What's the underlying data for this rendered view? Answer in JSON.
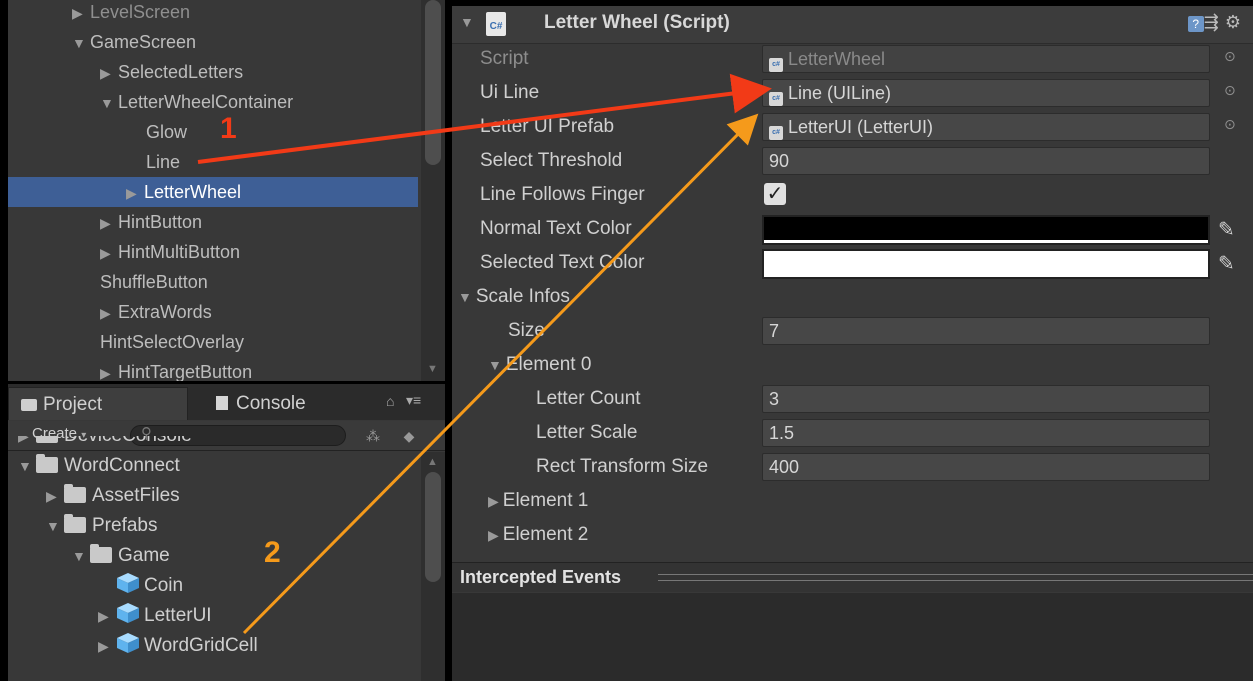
{
  "hierarchy": {
    "items": [
      {
        "label": "LevelScreen",
        "arrow": "▶",
        "indent": 1,
        "state": "dim"
      },
      {
        "label": "GameScreen",
        "arrow": "▼",
        "indent": 1,
        "state": ""
      },
      {
        "label": "SelectedLetters",
        "arrow": "▶",
        "indent": 2,
        "state": ""
      },
      {
        "label": "LetterWheelContainer",
        "arrow": "▼",
        "indent": 2,
        "state": ""
      },
      {
        "label": "Glow",
        "arrow": "",
        "indent": 3,
        "state": ""
      },
      {
        "label": "Line",
        "arrow": "",
        "indent": 3,
        "state": ""
      },
      {
        "label": "LetterWheel",
        "arrow": "▶",
        "indent": 3,
        "state": "sel"
      },
      {
        "label": "HintButton",
        "arrow": "▶",
        "indent": 2,
        "state": ""
      },
      {
        "label": "HintMultiButton",
        "arrow": "▶",
        "indent": 2,
        "state": ""
      },
      {
        "label": "ShuffleButton",
        "arrow": "",
        "indent": 2,
        "state": ""
      },
      {
        "label": "ExtraWords",
        "arrow": "▶",
        "indent": 2,
        "state": ""
      },
      {
        "label": "HintSelectOverlay",
        "arrow": "",
        "indent": 2,
        "state": ""
      },
      {
        "label": "HintTargetButton",
        "arrow": "▶",
        "indent": 2,
        "state": ""
      }
    ]
  },
  "project": {
    "tabs": [
      {
        "label": "Project",
        "icon": "folder-icon",
        "active": true
      },
      {
        "label": "Console",
        "icon": "console-icon",
        "active": false
      }
    ],
    "create_label": "Create",
    "search_placeholder": "",
    "items": [
      {
        "label": "DeviceConsole",
        "arrow": "▶",
        "indent": 0,
        "icon": "folder"
      },
      {
        "label": "WordConnect",
        "arrow": "▼",
        "indent": 0,
        "icon": "folder"
      },
      {
        "label": "AssetFiles",
        "arrow": "▶",
        "indent": 1,
        "icon": "folder"
      },
      {
        "label": "Prefabs",
        "arrow": "▼",
        "indent": 1,
        "icon": "folder"
      },
      {
        "label": "Game",
        "arrow": "▼",
        "indent": 2,
        "icon": "folder"
      },
      {
        "label": "Coin",
        "arrow": "",
        "indent": 3,
        "icon": "prefab"
      },
      {
        "label": "LetterUI",
        "arrow": "▶",
        "indent": 3,
        "icon": "prefab"
      },
      {
        "label": "WordGridCell",
        "arrow": "▶",
        "indent": 3,
        "icon": "prefab"
      }
    ]
  },
  "inspector": {
    "component_title": "Letter Wheel (Script)",
    "cs_icon_text": "C#",
    "script_label": "Script",
    "script_value": "LetterWheel",
    "ui_line_label": "Ui Line",
    "ui_line_value": "Line (UILine)",
    "letter_ui_prefab_label": "Letter UI Prefab",
    "letter_ui_prefab_value": "LetterUI (LetterUI)",
    "select_threshold_label": "Select Threshold",
    "select_threshold_value": "90",
    "line_follows_finger_label": "Line Follows Finger",
    "line_follows_finger_checked": true,
    "normal_text_color_label": "Normal Text Color",
    "normal_text_color": "#000000",
    "selected_text_color_label": "Selected Text Color",
    "selected_text_color": "#ffffff",
    "scale_infos_label": "Scale Infos",
    "size_label": "Size",
    "size_value": "7",
    "element0_label": "Element 0",
    "letter_count_label": "Letter Count",
    "letter_count_value": "3",
    "letter_scale_label": "Letter Scale",
    "letter_scale_value": "1.5",
    "rect_transform_size_label": "Rect Transform Size",
    "rect_transform_size_value": "400",
    "element1_label": "Element 1",
    "element2_label": "Element 2",
    "events_title": "Intercepted Events"
  },
  "annotations": {
    "label_1": "1",
    "label_2": "2",
    "color_1": "#f23a17",
    "color_2": "#f59a1b"
  }
}
